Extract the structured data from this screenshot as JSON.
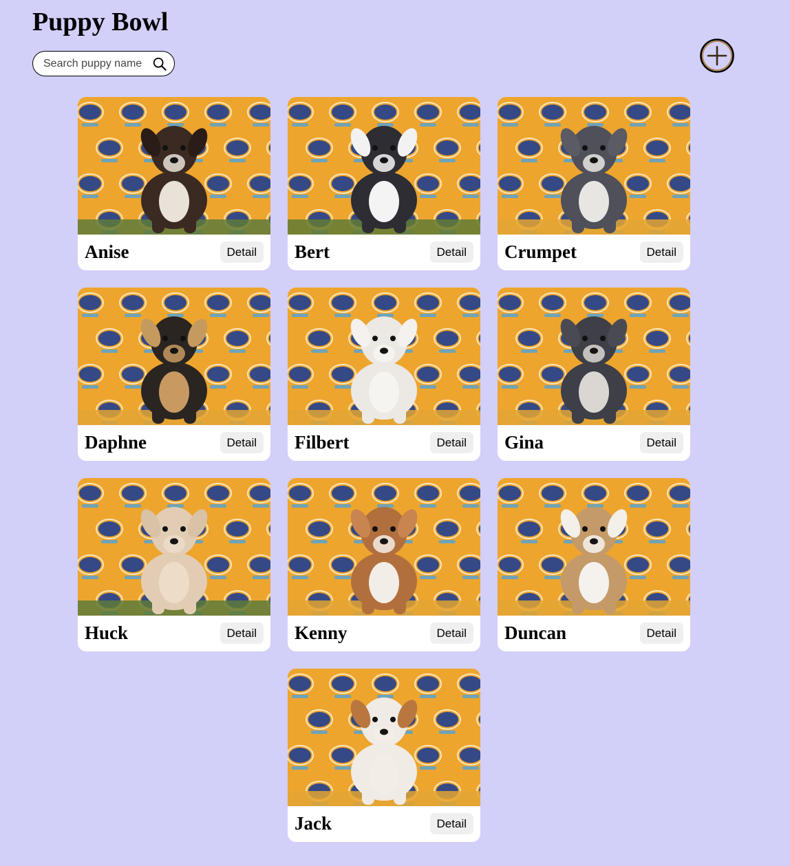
{
  "header": {
    "title": "Puppy Bowl"
  },
  "search": {
    "placeholder": "Search puppy name",
    "value": ""
  },
  "add_button": {
    "icon": "plus-circle-icon",
    "color": "#8b5a1e"
  },
  "colors": {
    "background": "#d2cff9",
    "card": "#ffffff",
    "photo_backdrop": "#eea52e",
    "logo_blue": "#1f3f8f",
    "button": "#efefef"
  },
  "puppies": [
    {
      "name": "Anise",
      "detail_label": "Detail",
      "fur": "#3a2a22",
      "accent": "#2a1c16",
      "chest": "#e9e2d8",
      "floor": "#5e7a3a"
    },
    {
      "name": "Bert",
      "detail_label": "Detail",
      "fur": "#2d2d33",
      "accent": "#f2f2f2",
      "chest": "#f4f4f4",
      "floor": "#617a35"
    },
    {
      "name": "Crumpet",
      "detail_label": "Detail",
      "fur": "#4f5059",
      "accent": "#5a5b63",
      "chest": "#e8e6e2",
      "floor": "#e3a532"
    },
    {
      "name": "Daphne",
      "detail_label": "Detail",
      "fur": "#2a2520",
      "accent": "#c59a5e",
      "chest": "#c89a62",
      "floor": "#e3a532"
    },
    {
      "name": "Filbert",
      "detail_label": "Detail",
      "fur": "#ece8e4",
      "accent": "#f4f1ee",
      "chest": "#f6f4f1",
      "floor": "#e3a532"
    },
    {
      "name": "Gina",
      "detail_label": "Detail",
      "fur": "#3e3f47",
      "accent": "#4a4b52",
      "chest": "#dad7d2",
      "floor": "#e3a532"
    },
    {
      "name": "Huck",
      "detail_label": "Detail",
      "fur": "#e2cdb4",
      "accent": "#d9c2a6",
      "chest": "#ecdcc8",
      "floor": "#5e7a3a"
    },
    {
      "name": "Kenny",
      "detail_label": "Detail",
      "fur": "#b26f3e",
      "accent": "#c88550",
      "chest": "#f2ede6",
      "floor": "#e3a532"
    },
    {
      "name": "Duncan",
      "detail_label": "Detail",
      "fur": "#c49a68",
      "accent": "#f3efe9",
      "chest": "#f5f2ee",
      "floor": "#e3a532"
    },
    {
      "name": "Jack",
      "detail_label": "Detail",
      "fur": "#f0ebe4",
      "accent": "#b9773f",
      "chest": "#f2ede6",
      "floor": "#e3a532"
    }
  ]
}
